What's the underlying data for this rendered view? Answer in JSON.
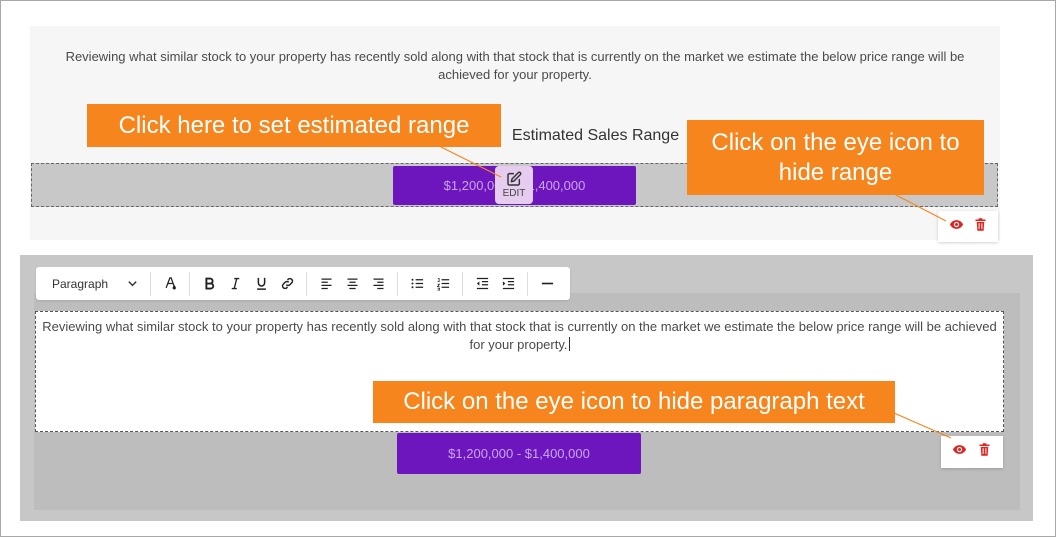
{
  "top_section": {
    "paragraph": "Reviewing what similar stock to your property has recently sold along with that stock that is currently on the market we estimate the below price range will be achieved for your property.",
    "heading": "Estimated Sales Range",
    "price_range": "$1,200,000 - $1,400,000",
    "edit_label": "EDIT"
  },
  "toolbar": {
    "format_select": "Paragraph",
    "icons": [
      "chevron-down-icon",
      "text-color-icon",
      "bold-icon",
      "italic-icon",
      "underline-icon",
      "link-icon",
      "align-left-icon",
      "align-center-icon",
      "align-right-icon",
      "bullet-list-icon",
      "numbered-list-icon",
      "outdent-icon",
      "indent-icon",
      "horizontal-rule-icon"
    ]
  },
  "editor_section": {
    "paragraph": "Reviewing what similar stock to your property has recently sold along with that stock that is currently on the market we estimate the below price range will be achieved for your property.",
    "price_range": "$1,200,000 - $1,400,000"
  },
  "callouts": {
    "set_range": "Click here to set estimated range",
    "hide_range": "Click on the eye icon to hide range",
    "hide_paragraph": "Click on the eye icon to hide paragraph text"
  },
  "colors": {
    "accent_orange": "#f7851d",
    "price_purple": "#6e16bd",
    "price_text": "#c9a5f0",
    "action_red": "#e02424"
  }
}
